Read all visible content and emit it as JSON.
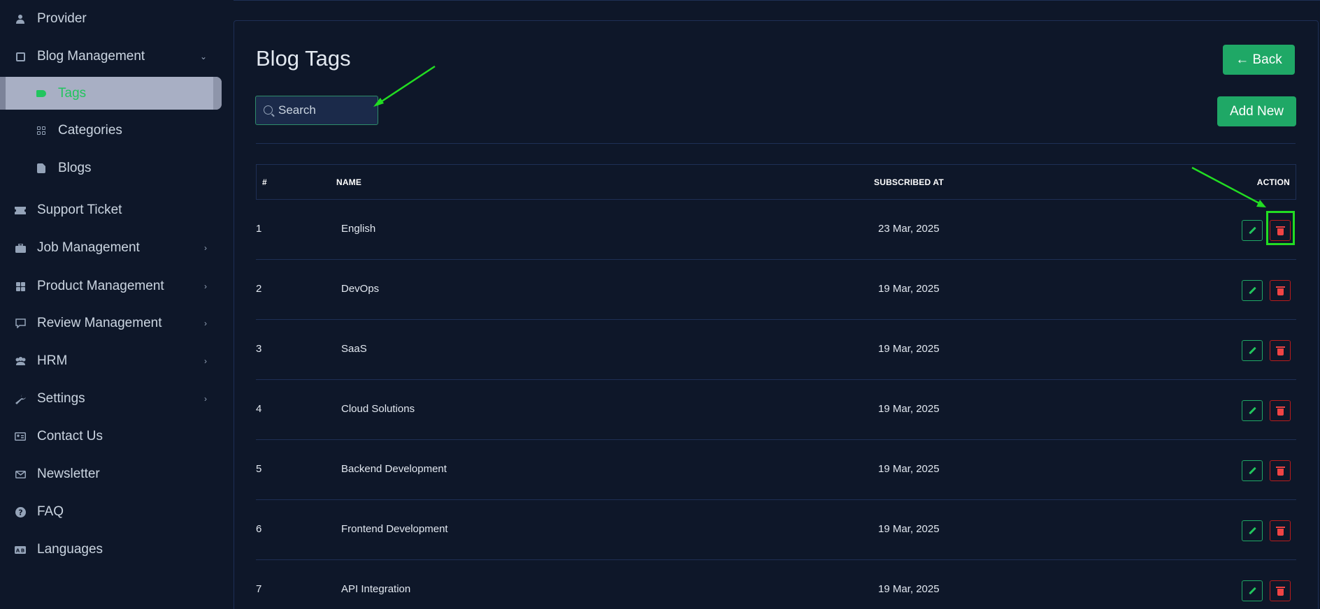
{
  "sidebar": {
    "items": [
      {
        "label": "Provider",
        "icon": "user-icon"
      },
      {
        "label": "Blog Management",
        "icon": "blog-icon"
      },
      {
        "label": "Tags",
        "icon": "tag-icon"
      },
      {
        "label": "Categories",
        "icon": "categories-icon"
      },
      {
        "label": "Blogs",
        "icon": "blogs-icon"
      },
      {
        "label": "Support Ticket",
        "icon": "ticket-icon"
      },
      {
        "label": "Job Management",
        "icon": "briefcase-icon"
      },
      {
        "label": "Product Management",
        "icon": "grid-icon"
      },
      {
        "label": "Review Management",
        "icon": "review-icon"
      },
      {
        "label": "HRM",
        "icon": "users-icon"
      },
      {
        "label": "Settings",
        "icon": "wrench-icon"
      },
      {
        "label": "Contact Us",
        "icon": "contact-icon"
      },
      {
        "label": "Newsletter",
        "icon": "mail-icon"
      },
      {
        "label": "FAQ",
        "icon": "question-icon"
      },
      {
        "label": "Languages",
        "icon": "language-icon"
      }
    ]
  },
  "page": {
    "title": "Blog Tags",
    "back_label": "← Back",
    "add_label": "Add New",
    "search_placeholder": "Search"
  },
  "table": {
    "headers": [
      "#",
      "NAME",
      "SUBSCRIBED AT",
      "ACTION"
    ],
    "rows": [
      {
        "num": "1",
        "name": "English",
        "date": "23 Mar, 2025"
      },
      {
        "num": "2",
        "name": "DevOps",
        "date": "19 Mar, 2025"
      },
      {
        "num": "3",
        "name": "SaaS",
        "date": "19 Mar, 2025"
      },
      {
        "num": "4",
        "name": "Cloud Solutions",
        "date": "19 Mar, 2025"
      },
      {
        "num": "5",
        "name": "Backend Development",
        "date": "19 Mar, 2025"
      },
      {
        "num": "6",
        "name": "Frontend Development",
        "date": "19 Mar, 2025"
      },
      {
        "num": "7",
        "name": "API Integration",
        "date": "19 Mar, 2025"
      }
    ]
  },
  "colors": {
    "background": "#0e1729",
    "accent_green": "#1fa866",
    "danger_red": "#ef4444",
    "annotation_green": "#22dd22"
  }
}
